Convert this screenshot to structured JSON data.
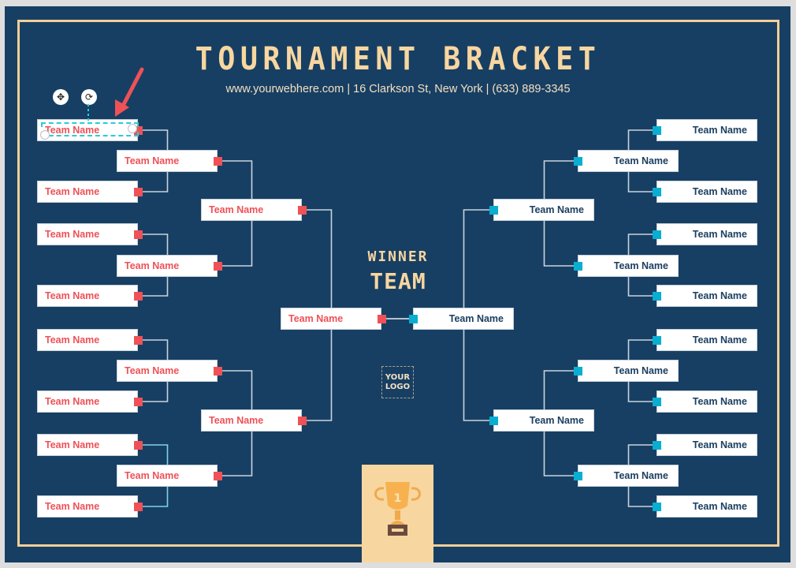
{
  "header": {
    "title": "TOURNAMENT BRACKET",
    "subtitle": "www.yourwebhere.com | 16 Clarkson St, New York | (633) 889-3345"
  },
  "colors": {
    "background": "#173f63",
    "accent_gold": "#f8d6a0",
    "left_team": "#ef5157",
    "right_team": "#09aed0",
    "right_text": "#1c3f60"
  },
  "left": {
    "round1": [
      "Team Name",
      "Team Name",
      "Team Name",
      "Team Name",
      "Team Name",
      "Team Name",
      "Team Name",
      "Team Name"
    ],
    "round2": [
      "Team Name",
      "Team Name",
      "Team Name",
      "Team Name"
    ],
    "round3": [
      "Team Name",
      "Team Name"
    ],
    "final": "Team Name"
  },
  "right": {
    "round1": [
      "Team Name",
      "Team Name",
      "Team Name",
      "Team Name",
      "Team Name",
      "Team Name",
      "Team Name",
      "Team Name"
    ],
    "round2": [
      "Team Name",
      "Team Name",
      "Team Name",
      "Team Name"
    ],
    "round3": [
      "Team Name",
      "Team Name"
    ],
    "final": "Team Name"
  },
  "winner": {
    "line1": "WINNER",
    "line2": "TEAM"
  },
  "logo": {
    "line1": "YOUR",
    "line2": "LOGO"
  },
  "trophy": {
    "rank": "1"
  },
  "editor": {
    "move_tool": "move-icon",
    "rotate_tool": "rotate-icon",
    "selected_element": "left-round1-team-1"
  }
}
